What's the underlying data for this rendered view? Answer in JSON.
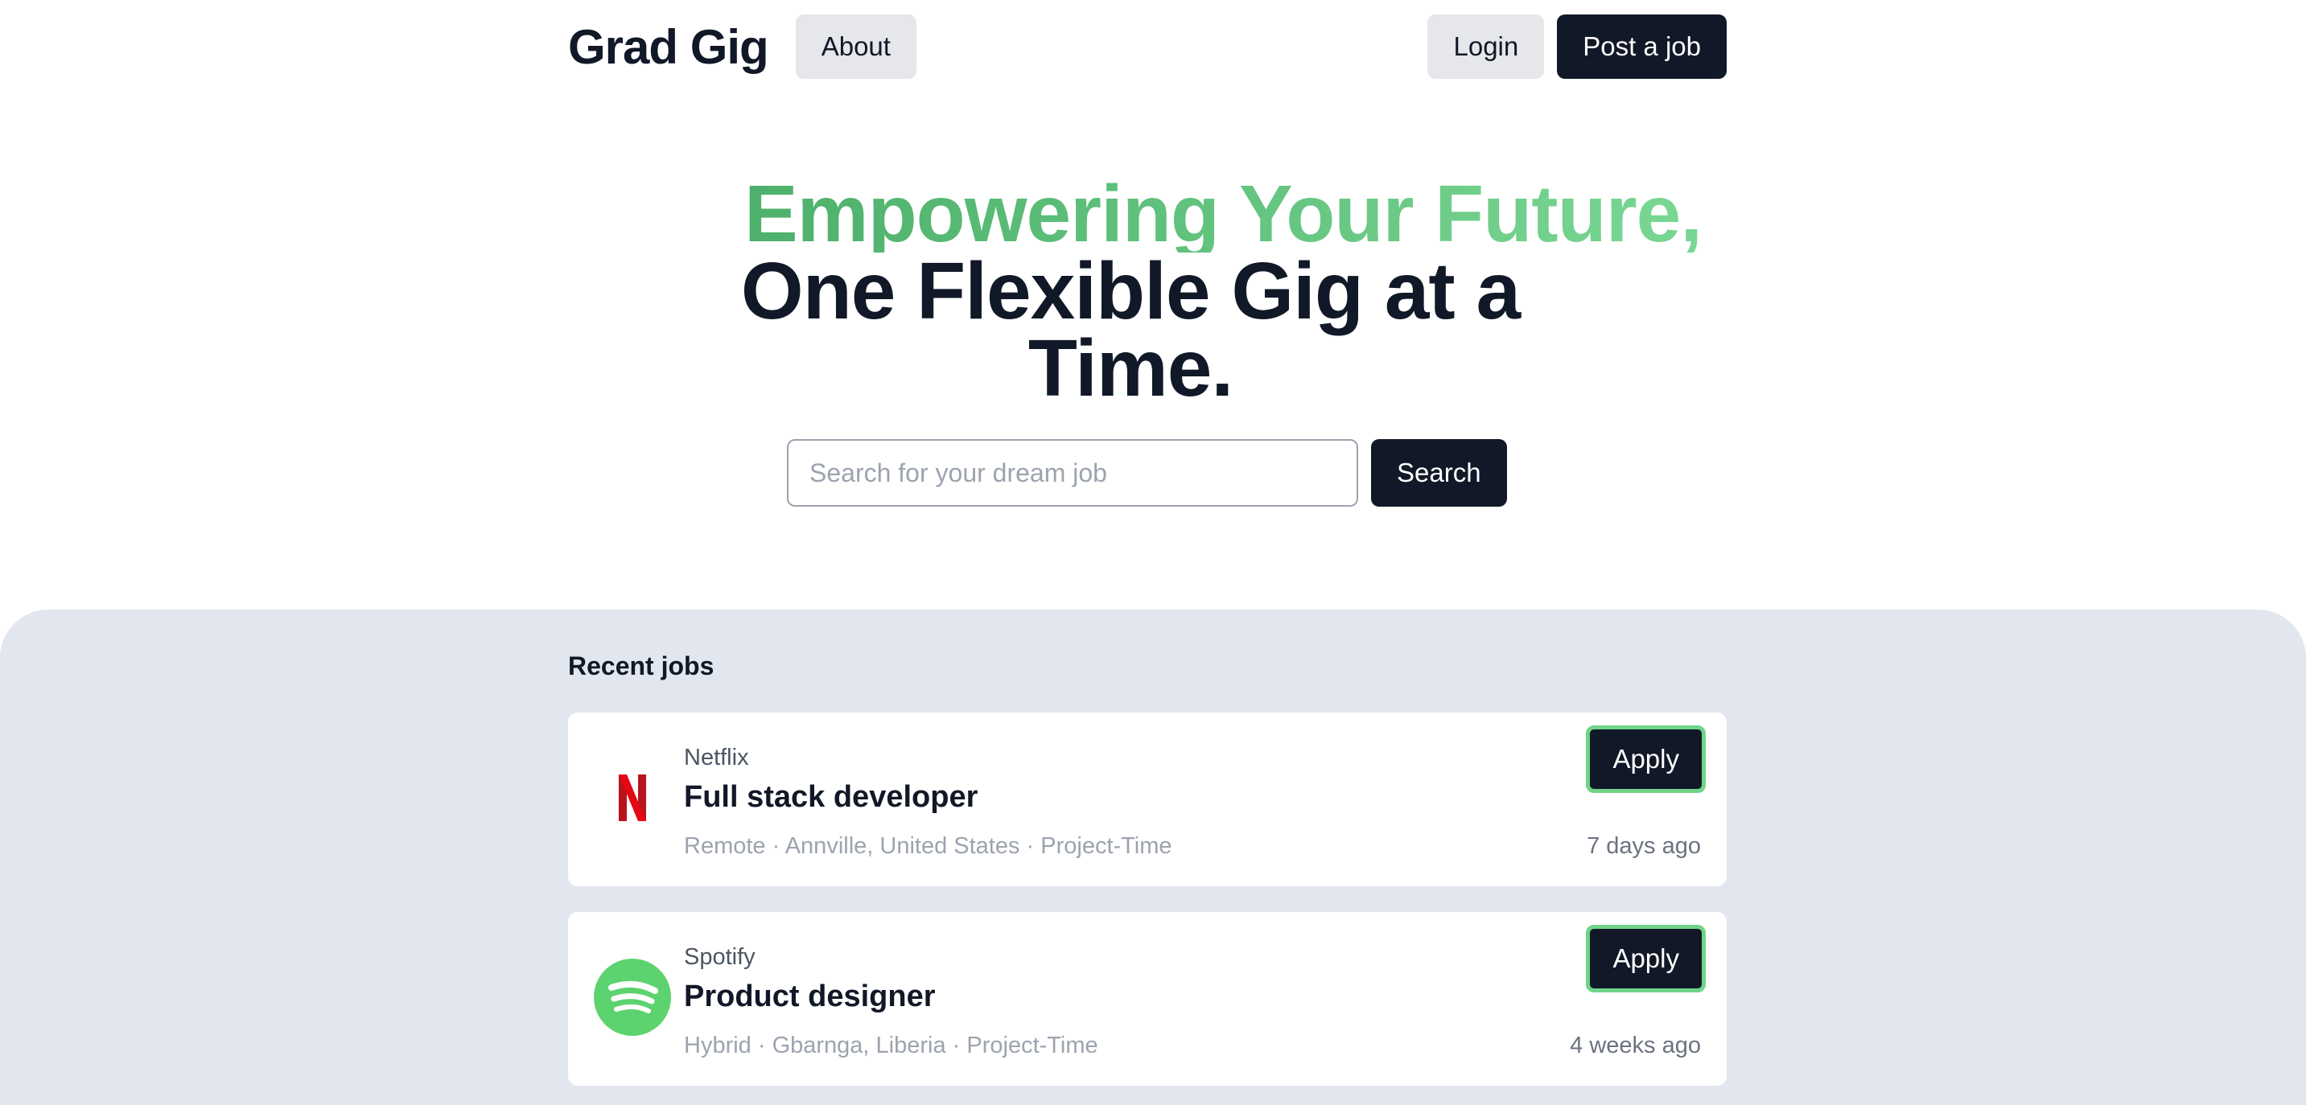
{
  "header": {
    "brand": "Grad Gig",
    "about_label": "About",
    "login_label": "Login",
    "post_job_label": "Post a job"
  },
  "hero": {
    "line1": "Empowering Your Future,",
    "line2": "One Flexible Gig at a Time."
  },
  "search": {
    "placeholder": "Search for your dream job",
    "button_label": "Search"
  },
  "jobs": {
    "title": "Recent jobs",
    "items": [
      {
        "company": "Netflix",
        "logo": "netflix-logo",
        "title": "Full stack developer",
        "meta": "Remote · Annville, United States · Project-Time",
        "posted": "7 days ago",
        "apply_label": "Apply"
      },
      {
        "company": "Spotify",
        "logo": "spotify-logo",
        "title": "Product designer",
        "meta": "Hybrid · Gbarnga, Liberia · Project-Time",
        "posted": "4 weeks ago",
        "apply_label": "Apply"
      }
    ]
  },
  "colors": {
    "primary_dark": "#111827",
    "accent_green": "#6fd488",
    "section_bg": "#e2e6ee",
    "netflix_red": "#b8141c",
    "spotify_green": "#5dd36f"
  }
}
